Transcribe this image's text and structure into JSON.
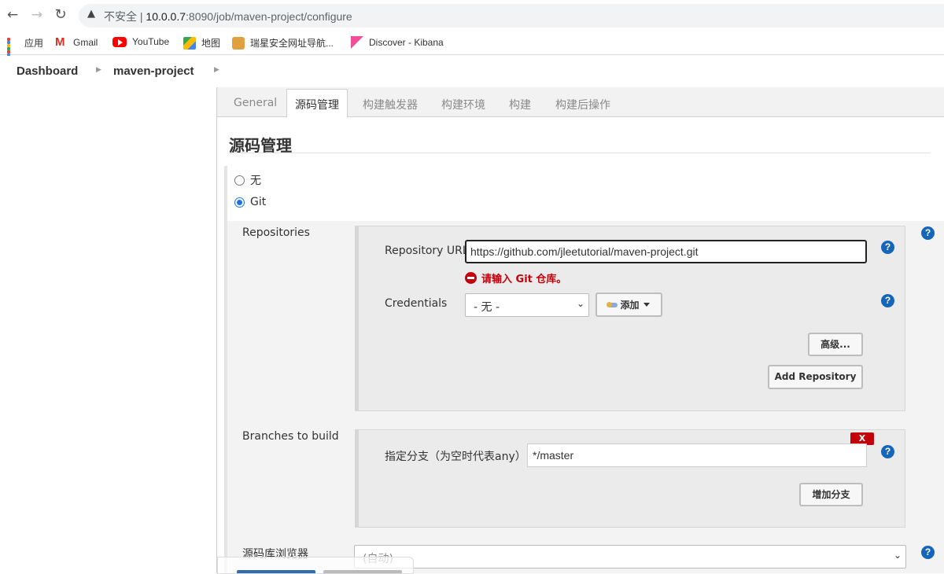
{
  "browser": {
    "insecure_label": "不安全",
    "url_host": "10.0.0.7",
    "url_rest": ":8090/job/maven-project/configure",
    "bookmarks": [
      "应用",
      "Gmail",
      "YouTube",
      "地图",
      "瑞星安全网址导航...",
      "Discover - Kibana"
    ]
  },
  "breadcrumb": {
    "items": [
      "Dashboard",
      "maven-project"
    ]
  },
  "tabs": [
    "General",
    "源码管理",
    "构建触发器",
    "构建环境",
    "构建",
    "构建后操作"
  ],
  "active_tab": "源码管理",
  "section": {
    "title": "源码管理",
    "scm_options": [
      {
        "label": "无",
        "selected": false
      },
      {
        "label": "Git",
        "selected": true
      }
    ]
  },
  "repositories": {
    "label": "Repositories",
    "url_label": "Repository URL",
    "url_value": "https://github.com/jleetutorial/maven-project.git",
    "error": "请输入 Git 仓库。",
    "credentials_label": "Credentials",
    "credentials_value": "- 无 -",
    "add_button": "添加",
    "advanced_button": "高级...",
    "add_repo_button": "Add Repository"
  },
  "branches": {
    "label": "Branches to build",
    "spec_label": "指定分支（为空时代表any）",
    "spec_value": "*/master",
    "delete_button": "X",
    "add_branch_button": "增加分支"
  },
  "browser_select": {
    "label": "源码库浏览器",
    "value": "(自动)"
  },
  "colors": {
    "help": "#1565b8",
    "error": "#c4000a",
    "radio": "#1a73e8"
  }
}
